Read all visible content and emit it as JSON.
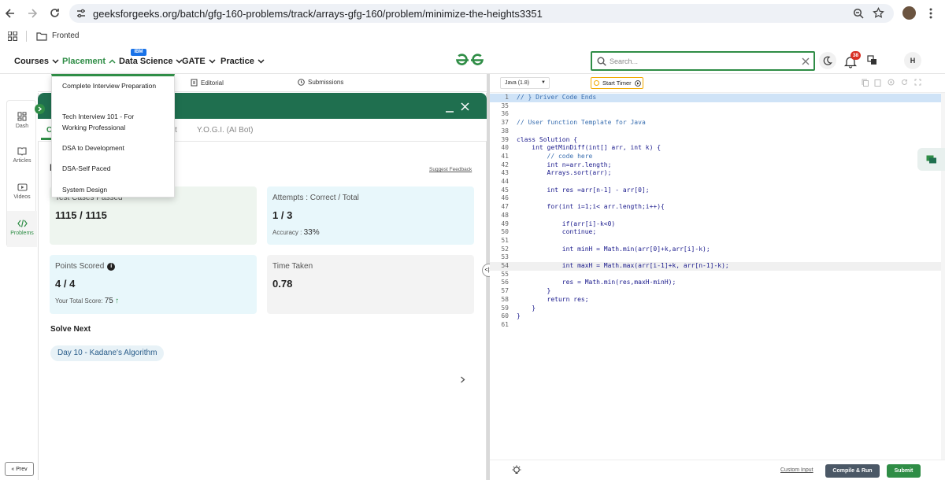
{
  "browser": {
    "url": "geeksforgeeks.org/batch/gfg-160-problems/track/arrays-gfg-160/problem/minimize-the-heights3351",
    "avatar_letter": "",
    "bookmark_folder": "Fronted"
  },
  "nav": {
    "items": [
      "Courses",
      "Placement",
      "Data Science",
      "GATE",
      "Practice"
    ],
    "ibm_badge": "IBM",
    "search_placeholder": "Search...",
    "notification_count": "38",
    "user_initial": "H"
  },
  "placement_menu": [
    "Complete Interview Preparation",
    "Tech Interview 101 - For Working Professional",
    "DSA to Development",
    "DSA-Self Paced",
    "System Design"
  ],
  "rail": {
    "items": [
      "Dash",
      "Articles",
      "Videos",
      "Problems"
    ],
    "prev_label": "Prev"
  },
  "problem_tabs": [
    "Editorial",
    "Submissions"
  ],
  "modal": {
    "tabs": [
      "C",
      "t",
      "Y.O.G.I. (AI Bot)"
    ],
    "section_initial": "I",
    "suggest_feedback": "Suggest Feedback",
    "test_cases_label": "Test Cases Passed",
    "test_cases_value": "1115 / 1115",
    "attempts_label": "Attempts : Correct / Total",
    "attempts_value": "1 / 3",
    "accuracy_label": "Accuracy :",
    "accuracy_value": "33%",
    "points_label": "Points Scored",
    "points_value": "4 / 4",
    "total_score_label": "Your Total Score:",
    "total_score_value": "75",
    "time_label": "Time Taken",
    "time_value": "0.78",
    "solve_next_label": "Solve Next",
    "solve_next_item": "Day 10 - Kadane's Algorithm"
  },
  "editor": {
    "language": "Java (1.8)",
    "timer_label": "Start Timer",
    "custom_input": "Custom Input",
    "compile_label": "Compile & Run",
    "submit_label": "Submit",
    "lines": [
      {
        "n": "1",
        "text": "// } Driver Code Ends"
      },
      {
        "n": "35",
        "text": ""
      },
      {
        "n": "36",
        "text": ""
      },
      {
        "n": "37",
        "text": "// User function Template for Java"
      },
      {
        "n": "38",
        "text": ""
      },
      {
        "n": "39",
        "text": "class Solution {"
      },
      {
        "n": "40",
        "text": "    int getMinDiff(int[] arr, int k) {"
      },
      {
        "n": "41",
        "text": "        // code here"
      },
      {
        "n": "42",
        "text": "        int n=arr.length;"
      },
      {
        "n": "43",
        "text": "        Arrays.sort(arr);"
      },
      {
        "n": "44",
        "text": ""
      },
      {
        "n": "45",
        "text": "        int res =arr[n-1] - arr[0];"
      },
      {
        "n": "46",
        "text": ""
      },
      {
        "n": "47",
        "text": "        for(int i=1;i< arr.length;i++){"
      },
      {
        "n": "48",
        "text": ""
      },
      {
        "n": "49",
        "text": "            if(arr[i]-k<0)"
      },
      {
        "n": "50",
        "text": "            continue;"
      },
      {
        "n": "51",
        "text": ""
      },
      {
        "n": "52",
        "text": "            int minH = Math.min(arr[0]+k,arr[i]-k);"
      },
      {
        "n": "53",
        "text": ""
      },
      {
        "n": "54",
        "text": "            int maxH = Math.max(arr[i-1]+k, arr[n-1]-k);"
      },
      {
        "n": "55",
        "text": ""
      },
      {
        "n": "56",
        "text": "            res = Math.min(res,maxH-minH);"
      },
      {
        "n": "57",
        "text": "        }"
      },
      {
        "n": "58",
        "text": "        return res;"
      },
      {
        "n": "59",
        "text": "    }"
      },
      {
        "n": "60",
        "text": "}"
      },
      {
        "n": "61",
        "text": ""
      }
    ]
  },
  "colors": {
    "gfg_green": "#2f8d46",
    "modal_header": "#1f6f4f",
    "card_green": "#eef5ef",
    "card_blue": "#e8f7fb",
    "badge_red": "#d93025"
  }
}
